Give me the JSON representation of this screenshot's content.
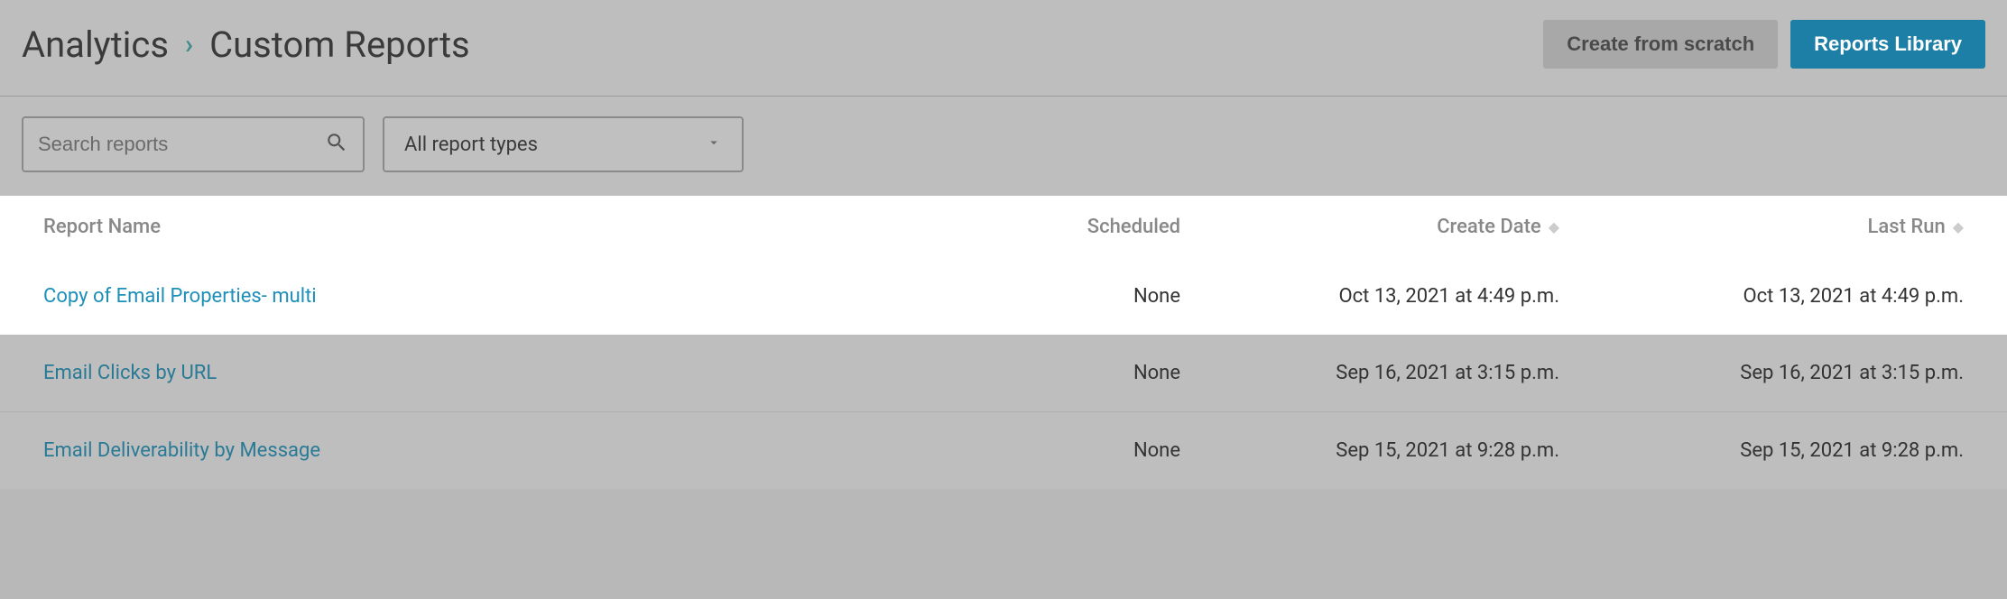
{
  "breadcrumb": {
    "root": "Analytics",
    "current": "Custom Reports"
  },
  "header": {
    "create_label": "Create from scratch",
    "library_label": "Reports Library"
  },
  "filters": {
    "search_placeholder": "Search reports",
    "type_selected": "All report types"
  },
  "table": {
    "columns": {
      "name": "Report Name",
      "scheduled": "Scheduled",
      "created": "Create Date",
      "last_run": "Last Run"
    },
    "rows": [
      {
        "name": "Copy of Email Properties- multi",
        "scheduled": "None",
        "created": "Oct 13, 2021 at 4:49 p.m.",
        "last_run": "Oct 13, 2021 at 4:49 p.m.",
        "highlighted": true
      },
      {
        "name": "Email Clicks by URL",
        "scheduled": "None",
        "created": "Sep 16, 2021 at 3:15 p.m.",
        "last_run": "Sep 16, 2021 at 3:15 p.m.",
        "highlighted": false
      },
      {
        "name": "Email Deliverability by Message",
        "scheduled": "None",
        "created": "Sep 15, 2021 at 9:28 p.m.",
        "last_run": "Sep 15, 2021 at 9:28 p.m.",
        "highlighted": false
      }
    ]
  }
}
